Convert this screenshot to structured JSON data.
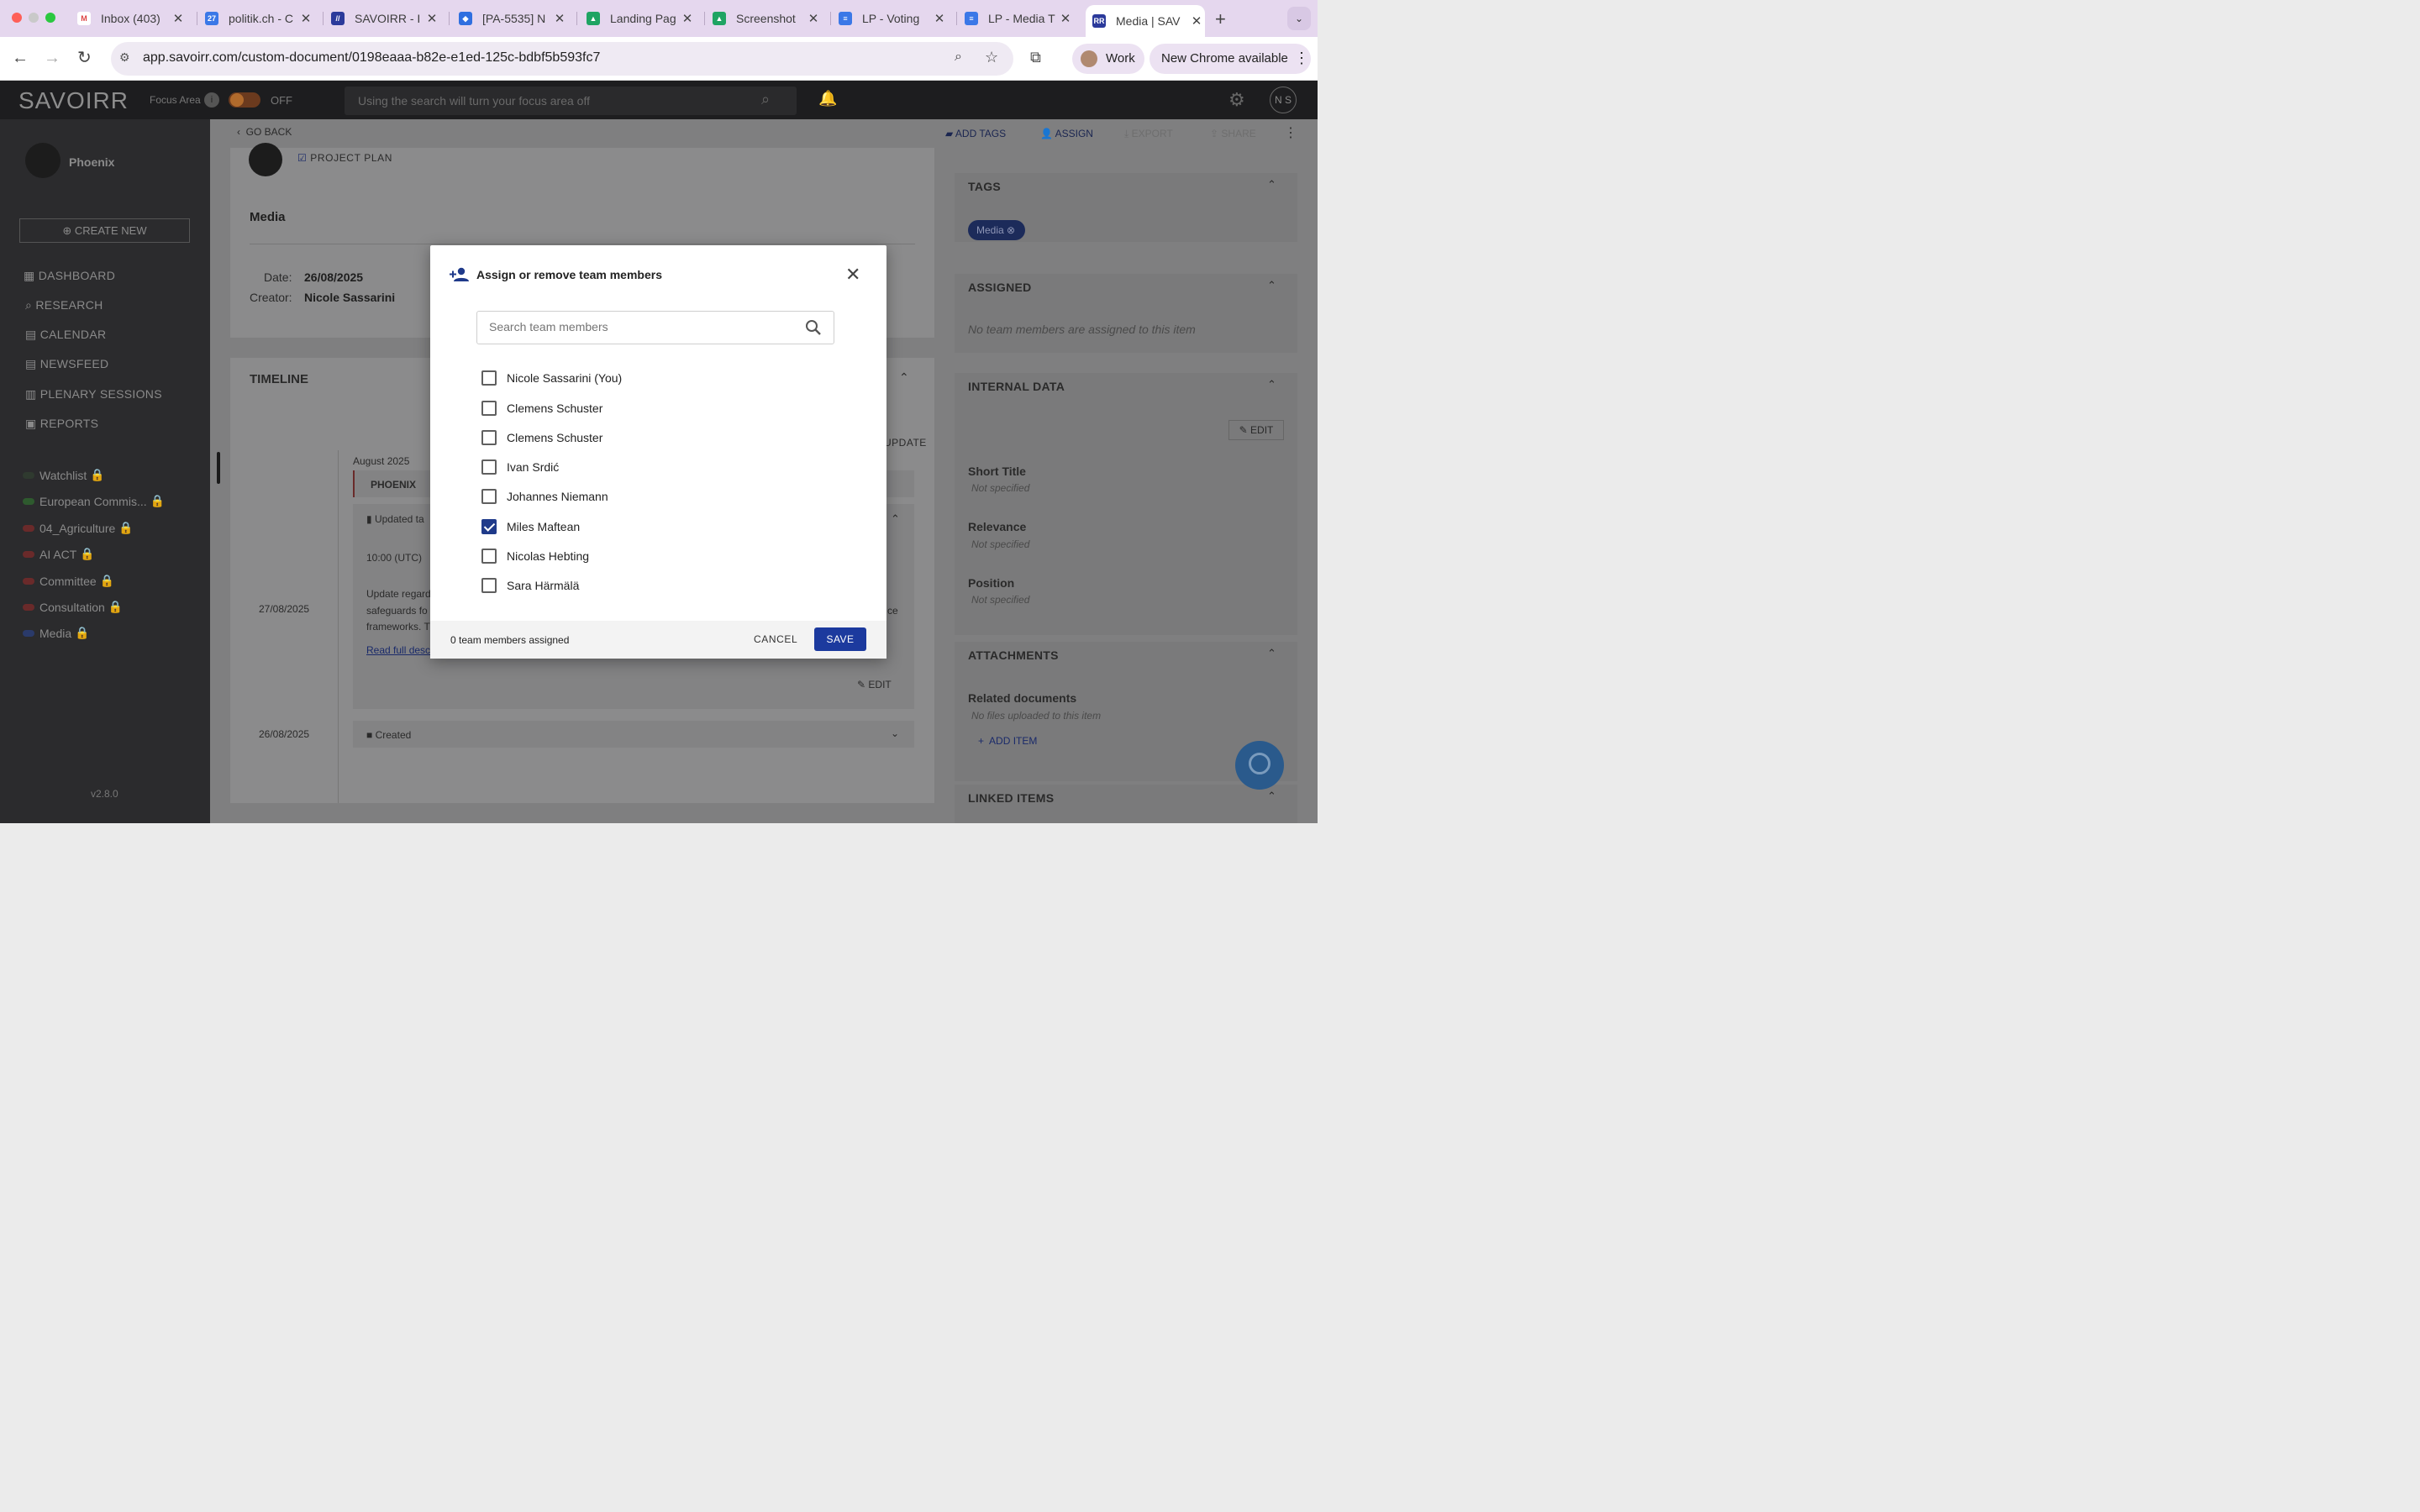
{
  "browser": {
    "tabs": [
      {
        "label": "Inbox (403)",
        "icon": "gmail-icon"
      },
      {
        "label": "politik.ch - C",
        "icon": "calendar-icon"
      },
      {
        "label": "SAVOIRR - I",
        "icon": "savoirr-icon"
      },
      {
        "label": "[PA-5535] N",
        "icon": "jira-icon"
      },
      {
        "label": "Landing Pag",
        "icon": "drive-icon"
      },
      {
        "label": "Screenshot",
        "icon": "drive-icon"
      },
      {
        "label": "LP - Voting",
        "icon": "docs-icon"
      },
      {
        "label": "LP - Media T",
        "icon": "docs-icon"
      },
      {
        "label": "Media | SAV",
        "icon": "savoirr-icon"
      }
    ],
    "url": "app.savoirr.com/custom-document/0198eaaa-b82e-e1ed-125c-bdbf5b593fc7",
    "profile_label": "Work",
    "update_label": "New Chrome available"
  },
  "app": {
    "logo": "SAVOIRR",
    "focus_area_label": "Focus Area",
    "focus_state": "OFF",
    "search_placeholder": "Using the search will turn your focus area off",
    "user_initials": "N S"
  },
  "sidebar": {
    "workspace": "Phoenix",
    "create_new": "CREATE NEW",
    "nav": [
      "DASHBOARD",
      "RESEARCH",
      "CALENDAR",
      "NEWSFEED",
      "PLENARY SESSIONS",
      "REPORTS"
    ],
    "watchlists": [
      {
        "label": "Watchlist",
        "color": "#2f3a2f"
      },
      {
        "label": "European Commis...",
        "color": "#2e5a2e"
      },
      {
        "label": "04_Agriculture",
        "color": "#6a2a2a"
      },
      {
        "label": "AI ACT",
        "color": "#6a2a2a"
      },
      {
        "label": "Committee",
        "color": "#6a2a2a"
      },
      {
        "label": "Consultation",
        "color": "#6a2a2a"
      },
      {
        "label": "Media",
        "color": "#2a3a6a"
      }
    ],
    "version": "v2.8.0"
  },
  "document": {
    "go_back": "GO BACK",
    "actions": [
      "ADD TAGS",
      "ASSIGN",
      "EXPORT",
      "SHARE"
    ],
    "type_label": "PROJECT PLAN",
    "title": "Media",
    "date_label": "Date:",
    "date_value": "26/08/2025",
    "creator_label": "Creator:",
    "creator_value": "Nicole Sassarini",
    "timeline_title": "TIMELINE",
    "timeline_month": "August 2025",
    "timeline_chip": "PHOENIX",
    "create_update": "UPDATE",
    "entry1_date": "27/08/2025",
    "entry1_status": "Updated ta",
    "entry1_time": "10:00 (UTC)",
    "entry1_text1": "Update regard",
    "entry1_text2": "safeguards fo",
    "entry1_text3": "frameworks. T",
    "entry1_text_right": "ce",
    "entry1_link": "Read full desc",
    "edit": "EDIT",
    "entry2_date": "26/08/2025",
    "entry2_status": "Created"
  },
  "right_panel": {
    "tags_title": "TAGS",
    "tag": "Media",
    "assigned_title": "ASSIGNED",
    "assigned_empty": "No team members are assigned to this item",
    "internal_title": "INTERNAL DATA",
    "edit": "EDIT",
    "fields": [
      {
        "label": "Short Title",
        "value": "Not specified"
      },
      {
        "label": "Relevance",
        "value": "Not specified"
      },
      {
        "label": "Position",
        "value": "Not specified"
      }
    ],
    "attachments_title": "ATTACHMENTS",
    "related_docs": "Related documents",
    "no_files": "No files uploaded to this item",
    "add_item": "ADD ITEM",
    "linked_title": "LINKED ITEMS"
  },
  "modal": {
    "title": "Assign or remove team members",
    "search_placeholder": "Search team members",
    "members": [
      {
        "name": "Nicole Sassarini (You)",
        "checked": false
      },
      {
        "name": "Clemens Schuster",
        "checked": false
      },
      {
        "name": "Clemens Schuster",
        "checked": false
      },
      {
        "name": "Ivan Srdić",
        "checked": false
      },
      {
        "name": "Johannes Niemann",
        "checked": false
      },
      {
        "name": "Miles Maftean",
        "checked": true
      },
      {
        "name": "Nicolas Hebting",
        "checked": false
      },
      {
        "name": "Sara Härmälä",
        "checked": false
      }
    ],
    "assigned_count": "0 team members assigned",
    "cancel": "CANCEL",
    "save": "SAVE"
  }
}
